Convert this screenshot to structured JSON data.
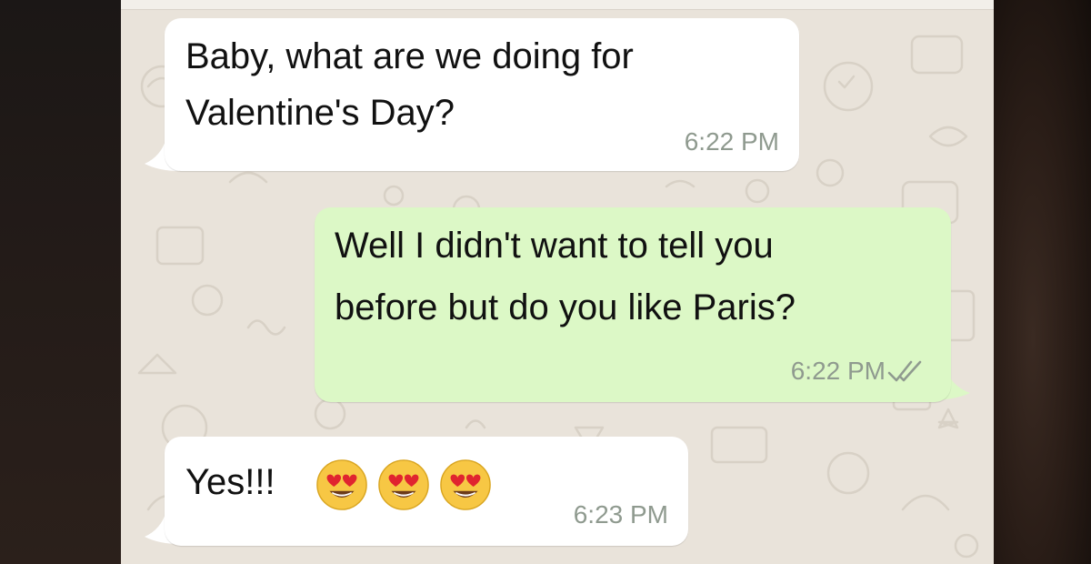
{
  "chat": {
    "messages": [
      {
        "direction": "incoming",
        "lines": [
          "Baby, what are we doing for",
          "Valentine's Day?"
        ],
        "time": "6:22 PM"
      },
      {
        "direction": "outgoing",
        "lines": [
          "Well I didn't want to tell you",
          "before but do you like Paris?"
        ],
        "time": "6:22 PM",
        "status_icon": "double-check-icon"
      },
      {
        "direction": "incoming",
        "text": "Yes!!!",
        "emojis": [
          "heart-eyes-emoji",
          "heart-eyes-emoji",
          "heart-eyes-emoji"
        ],
        "time": "6:23 PM"
      }
    ]
  },
  "colors": {
    "incoming_bubble": "#ffffff",
    "outgoing_bubble": "#dcf8c6",
    "wallpaper": "#e9e3da",
    "timestamp": "#8f9a8f",
    "read_check": "#8f9a8f"
  }
}
